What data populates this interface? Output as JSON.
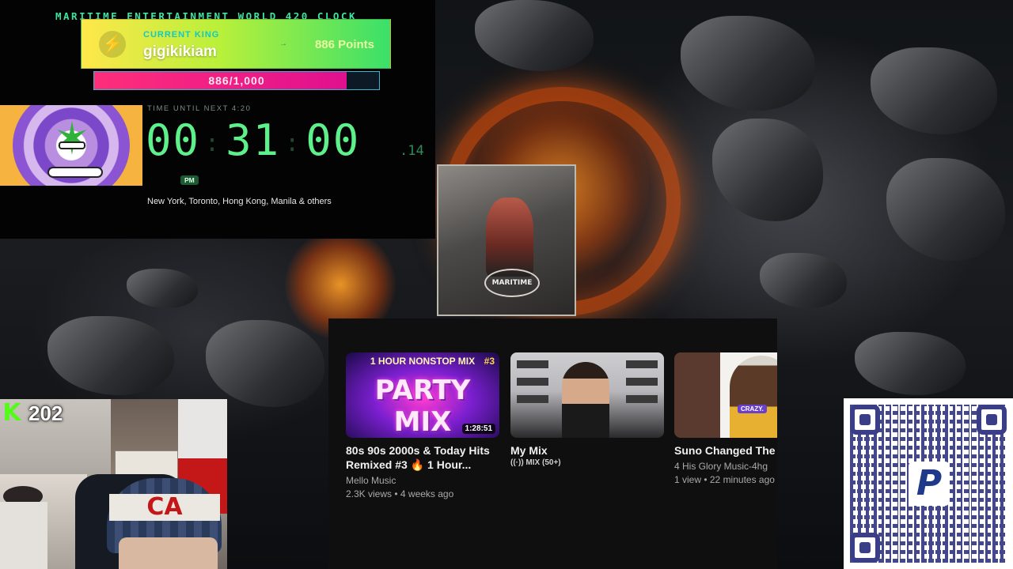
{
  "clock": {
    "header": "MARITIME ENTERTAINMENT WORLD 420 CLOCK",
    "king_label": "CURRENT KING",
    "king_name": "gigikikiam",
    "king_points": "886 Points",
    "progress_text": "886/1,000",
    "progress_fraction": 0.886,
    "countdown_label": "TIME UNTIL NEXT 4:20",
    "hours": "00",
    "minutes": "31",
    "seconds": "00",
    "fraction": ".14",
    "ampm": "PM",
    "cities": "New York, Toronto, Hong Kong, Manila & others"
  },
  "stream": {
    "viewer_count": "202",
    "platform_icon": "kick-icon"
  },
  "youtube": {
    "cards": [
      {
        "thumb_top": "1 HOUR NONSTOP MIX",
        "thumb_title": "PARTY MIX",
        "thumb_tag": "#3",
        "duration": "1:28:51",
        "title": "80s 90s 2000s & Today Hits Remixed #3 🔥 1 Hour...",
        "channel": "Mello Music",
        "stats": "2.3K views • 4 weeks ago"
      },
      {
        "title": "My Mix",
        "sub": "((·)) MIX (50+)"
      },
      {
        "thumb_tag": "CRAZY.",
        "title": "Suno Changed The G",
        "channel": "4 His Glory Music-4hg",
        "stats": "1 view • 22 minutes ago"
      }
    ]
  },
  "poster": {
    "stamp": "MARITIME"
  },
  "qr": {
    "logo": "P",
    "icon": "paypal-icon"
  },
  "colors": {
    "clock_green": "#5ef08a",
    "progress_pink": "#ff2e7a",
    "kick_green": "#53fc18",
    "youtube_bg": "#0f0f0f",
    "qr_blue": "#3a3e86"
  }
}
